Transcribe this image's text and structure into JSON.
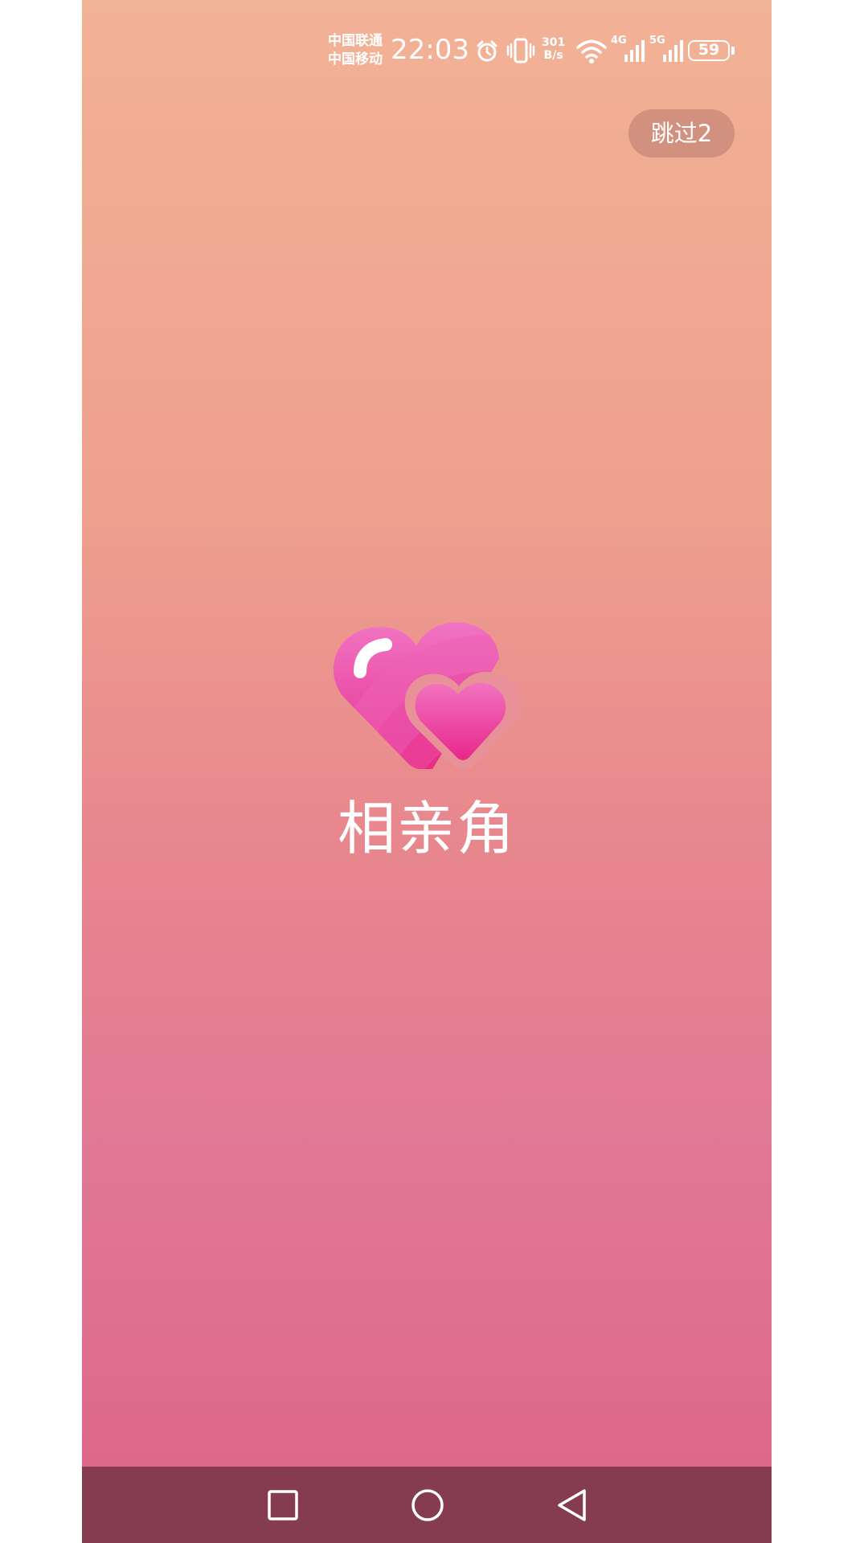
{
  "status_bar": {
    "carrier_1": "中国联通",
    "carrier_2": "中国移动",
    "time": "22:03",
    "speed_value": "301",
    "speed_unit": "B/s",
    "network_1": "4G",
    "network_2": "5G",
    "battery": "59",
    "icons": [
      "alarm-icon",
      "vibrate-icon",
      "wifi-icon",
      "signal-4g-icon",
      "signal-5g-icon",
      "battery-icon"
    ]
  },
  "skip_button": {
    "label": "跳过2"
  },
  "app": {
    "title": "相亲角",
    "logo_icon": "double-heart-logo-icon"
  },
  "nav_bar": {
    "icons": [
      "recent-apps-square-icon",
      "home-circle-icon",
      "back-triangle-icon"
    ]
  },
  "colors": {
    "gradient_top": "#f2b296",
    "gradient_bottom": "#de6488",
    "nav_bar": "#853b50",
    "logo_pink": "#ea2f8c",
    "logo_light": "#f06ec2"
  }
}
